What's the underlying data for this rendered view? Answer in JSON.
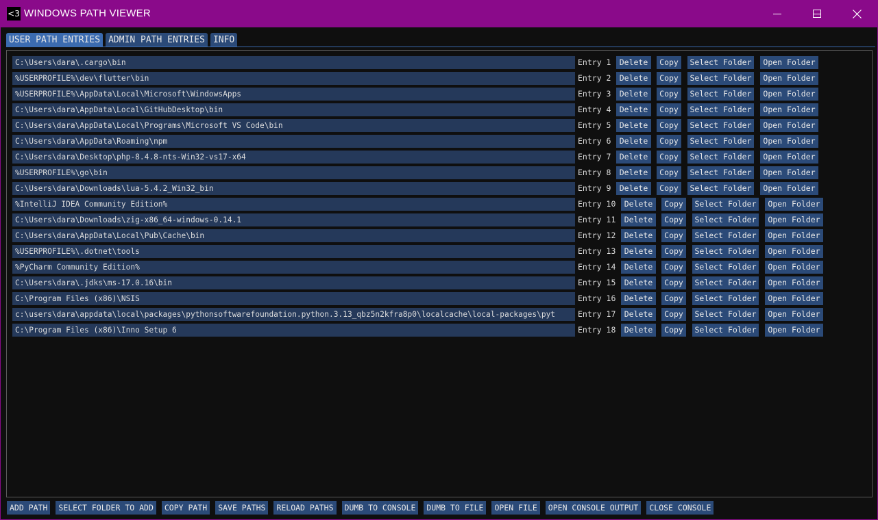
{
  "window": {
    "icon_text": "<3",
    "title": "WINDOWS PATH VIEWER"
  },
  "tabs": [
    {
      "label": "USER PATH ENTRIES",
      "active": true
    },
    {
      "label": "ADMIN PATH ENTRIES",
      "active": false
    },
    {
      "label": "INFO",
      "active": false
    }
  ],
  "entry_buttons": {
    "delete": "Delete",
    "copy": "Copy",
    "select_folder": "Select Folder",
    "open_folder": "Open Folder"
  },
  "entries": [
    {
      "path": "C:\\Users\\dara\\.cargo\\bin",
      "label": "Entry 1"
    },
    {
      "path": "%USERPROFILE%\\dev\\flutter\\bin",
      "label": "Entry 2"
    },
    {
      "path": "%USERPROFILE%\\AppData\\Local\\Microsoft\\WindowsApps",
      "label": "Entry 3"
    },
    {
      "path": "C:\\Users\\dara\\AppData\\Local\\GitHubDesktop\\bin",
      "label": "Entry 4"
    },
    {
      "path": "C:\\Users\\dara\\AppData\\Local\\Programs\\Microsoft VS Code\\bin",
      "label": "Entry 5"
    },
    {
      "path": "C:\\Users\\dara\\AppData\\Roaming\\npm",
      "label": "Entry 6"
    },
    {
      "path": "C:\\Users\\dara\\Desktop\\php-8.4.8-nts-Win32-vs17-x64",
      "label": "Entry 7"
    },
    {
      "path": "%USERPROFILE%\\go\\bin",
      "label": "Entry 8"
    },
    {
      "path": "C:\\Users\\dara\\Downloads\\lua-5.4.2_Win32_bin",
      "label": "Entry 9"
    },
    {
      "path": "%IntelliJ IDEA Community Edition%",
      "label": "Entry 10"
    },
    {
      "path": "C:\\Users\\dara\\Downloads\\zig-x86_64-windows-0.14.1",
      "label": "Entry 11"
    },
    {
      "path": "C:\\Users\\dara\\AppData\\Local\\Pub\\Cache\\bin",
      "label": "Entry 12"
    },
    {
      "path": "%USERPROFILE%\\.dotnet\\tools",
      "label": "Entry 13"
    },
    {
      "path": "%PyCharm Community Edition%",
      "label": "Entry 14"
    },
    {
      "path": "C:\\Users\\dara\\.jdks\\ms-17.0.16\\bin",
      "label": "Entry 15"
    },
    {
      "path": "C:\\Program Files (x86)\\NSIS",
      "label": "Entry 16"
    },
    {
      "path": "c:\\users\\dara\\appdata\\local\\packages\\pythonsoftwarefoundation.python.3.13_qbz5n2kfra8p0\\localcache\\local-packages\\pyt",
      "label": "Entry 17"
    },
    {
      "path": "C:\\Program Files (x86)\\Inno Setup 6",
      "label": "Entry 18"
    }
  ],
  "bottom_buttons": [
    {
      "name": "add-path-button",
      "label": "ADD PATH"
    },
    {
      "name": "select-folder-to-add-button",
      "label": "SELECT FOLDER TO ADD"
    },
    {
      "name": "copy-path-button",
      "label": "COPY PATH"
    },
    {
      "name": "save-paths-button",
      "label": "SAVE PATHS"
    },
    {
      "name": "reload-paths-button",
      "label": "RELOAD PATHS"
    },
    {
      "name": "dumb-to-console-button",
      "label": "DUMB TO CONSOLE"
    },
    {
      "name": "dumb-to-file-button",
      "label": "DUMB TO FILE"
    },
    {
      "name": "open-file-button",
      "label": "OPEN FILE"
    },
    {
      "name": "open-console-output-button",
      "label": "OPEN CONSOLE OUTPUT"
    },
    {
      "name": "close-console-button",
      "label": "CLOSE CONSOLE"
    }
  ],
  "colors": {
    "titlebar": "#8a0a8a",
    "background": "#0f0f0f",
    "field": "#25395a",
    "button": "#2b4a78",
    "tab_active": "#3b6bb0"
  }
}
